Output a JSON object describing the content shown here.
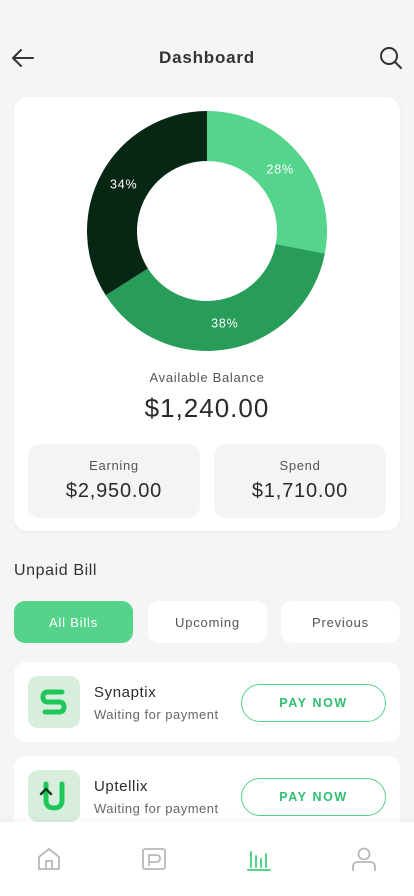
{
  "header": {
    "title": "Dashboard",
    "back_icon": "arrow-left-icon",
    "search_icon": "search-icon"
  },
  "balance": {
    "caption": "Available Balance",
    "value": "$1,240.00",
    "earning_label": "Earning",
    "earning_value": "$2,950.00",
    "spend_label": "Spend",
    "spend_value": "$1,710.00"
  },
  "chart_data": {
    "type": "pie",
    "donut": true,
    "slices": [
      {
        "label": "28%",
        "value": 28,
        "color": "#54d58b"
      },
      {
        "label": "38%",
        "value": 38,
        "color": "#279d59"
      },
      {
        "label": "34%",
        "value": 34,
        "color": "#062714"
      }
    ]
  },
  "bills": {
    "title": "Unpaid Bill",
    "tabs": [
      {
        "label": "All Bills",
        "active": true
      },
      {
        "label": "Upcoming",
        "active": false
      },
      {
        "label": "Previous",
        "active": false
      }
    ],
    "items": [
      {
        "name": "Synaptix",
        "status": "Waiting for payment",
        "action": "PAY NOW",
        "icon": "synaptix-logo-icon"
      },
      {
        "name": "Uptellix",
        "status": "Waiting for payment",
        "action": "PAY NOW",
        "icon": "uptellix-logo-icon"
      }
    ]
  },
  "nav": {
    "items": [
      {
        "icon": "home-icon",
        "active": false
      },
      {
        "icon": "wallet-icon",
        "active": false
      },
      {
        "icon": "bar-chart-icon",
        "active": true
      },
      {
        "icon": "user-icon",
        "active": false
      }
    ]
  },
  "colors": {
    "accent": "#55d38a",
    "accent_dark": "#2fbf6f",
    "background": "#f5f5f5",
    "card": "#ffffff",
    "inactive_icon": "#b8b8b8"
  }
}
